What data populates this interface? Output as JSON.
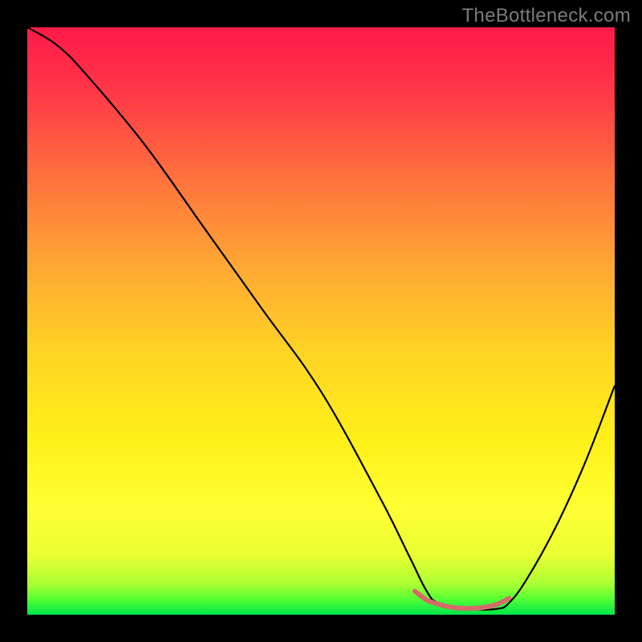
{
  "watermark": "TheBottleneck.com",
  "chart_data": {
    "type": "line",
    "title": "",
    "xlabel": "",
    "ylabel": "",
    "xlim": [
      0,
      100
    ],
    "ylim": [
      0,
      100
    ],
    "gradient_stops": [
      {
        "offset": 0.0,
        "color": "#ff1a49"
      },
      {
        "offset": 0.1,
        "color": "#ff3448"
      },
      {
        "offset": 0.25,
        "color": "#ff6f3d"
      },
      {
        "offset": 0.4,
        "color": "#ffa534"
      },
      {
        "offset": 0.55,
        "color": "#ffd324"
      },
      {
        "offset": 0.7,
        "color": "#fff019"
      },
      {
        "offset": 0.82,
        "color": "#ffff33"
      },
      {
        "offset": 0.9,
        "color": "#e9ff33"
      },
      {
        "offset": 0.95,
        "color": "#a6ff33"
      },
      {
        "offset": 0.975,
        "color": "#4dff33"
      },
      {
        "offset": 1.0,
        "color": "#00e64d"
      }
    ],
    "series": [
      {
        "name": "bottleneck-curve",
        "color": "#000000",
        "x": [
          0,
          5,
          10,
          20,
          30,
          40,
          50,
          60,
          65,
          68,
          70,
          75,
          80,
          82,
          85,
          90,
          95,
          100
        ],
        "y": [
          100,
          97,
          92,
          80,
          66,
          52,
          38,
          20,
          10,
          4,
          2,
          1,
          1,
          2,
          6,
          15,
          26,
          39
        ]
      },
      {
        "name": "plateau-marker",
        "color": "#d66a6a",
        "x": [
          66,
          68,
          70,
          72,
          74,
          76,
          78,
          80,
          82
        ],
        "y": [
          4,
          2.5,
          1.8,
          1.3,
          1.1,
          1.1,
          1.3,
          1.8,
          2.8
        ]
      }
    ]
  }
}
